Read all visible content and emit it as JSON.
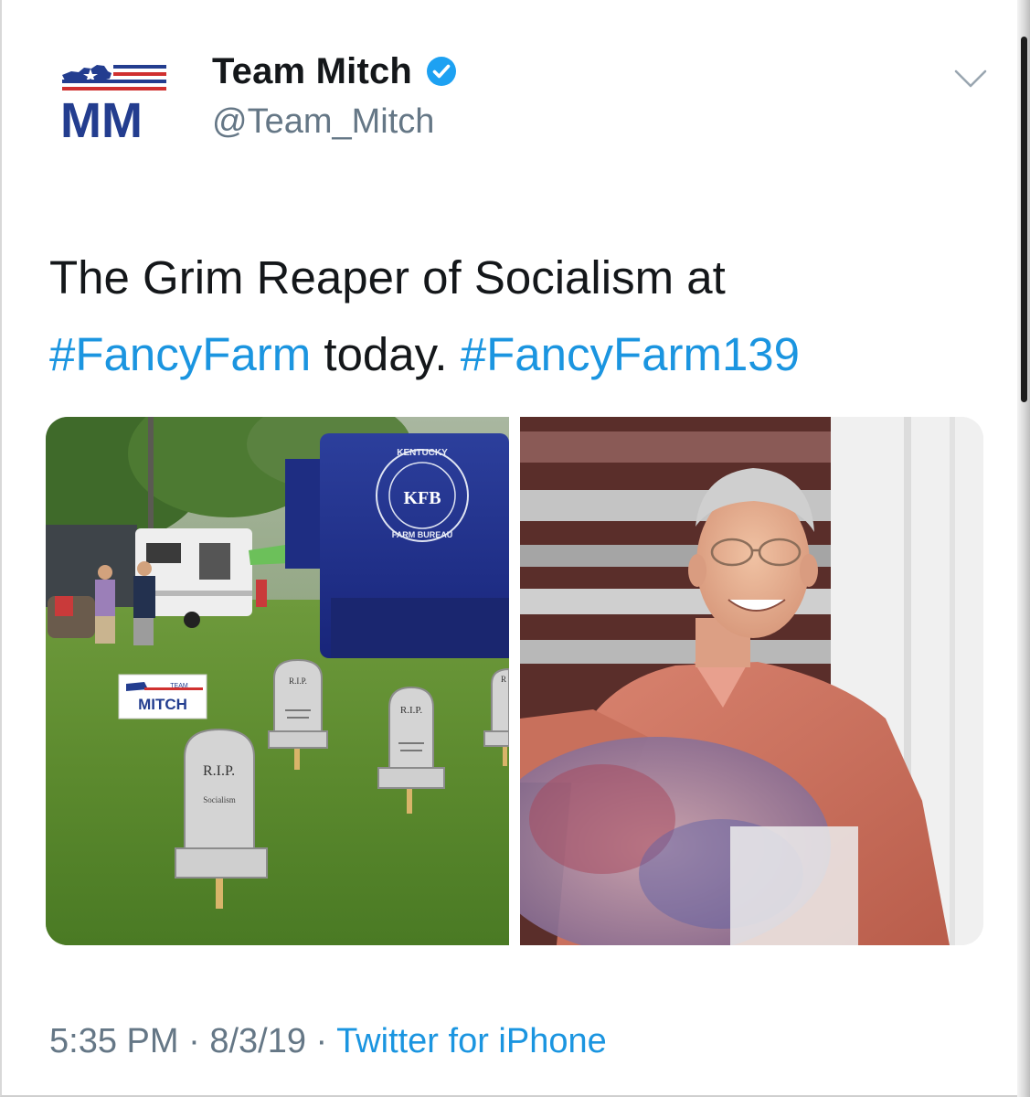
{
  "tweet": {
    "display_name": "Team Mitch",
    "handle": "@Team_Mitch",
    "avatar_text": "MM",
    "text_line1": "The Grim Reaper of Socialism at",
    "hashtag1": "#FancyFarm",
    "text_middle": " today. ",
    "hashtag2": "#FancyFarm139",
    "time": "5:35 PM",
    "separator": " · ",
    "date": "8/3/19",
    "source": "Twitter for iPhone"
  },
  "media_left": {
    "truck_logo": "KFB",
    "truck_ring_top": "KENTUCKY",
    "truck_ring_bottom": "FARM BUREAU",
    "sign_top": "TEAM",
    "sign_main": "MITCH",
    "stone1_title": "R.I.P.",
    "stone1_sub": "Socialism",
    "stone2_title": "R.I.P.",
    "stone3_title": "R.I.P.",
    "stone4_title": "R"
  },
  "colors": {
    "link": "#1b95e0",
    "text": "#14171a",
    "muted": "#657786",
    "brand_navy": "#233d8f",
    "brand_red": "#d0302f",
    "verified": "#1da1f2"
  },
  "icons": {
    "verified": "verified-badge-icon",
    "caret": "chevron-down-icon",
    "avatar_flag": "kentucky-flag-icon"
  }
}
